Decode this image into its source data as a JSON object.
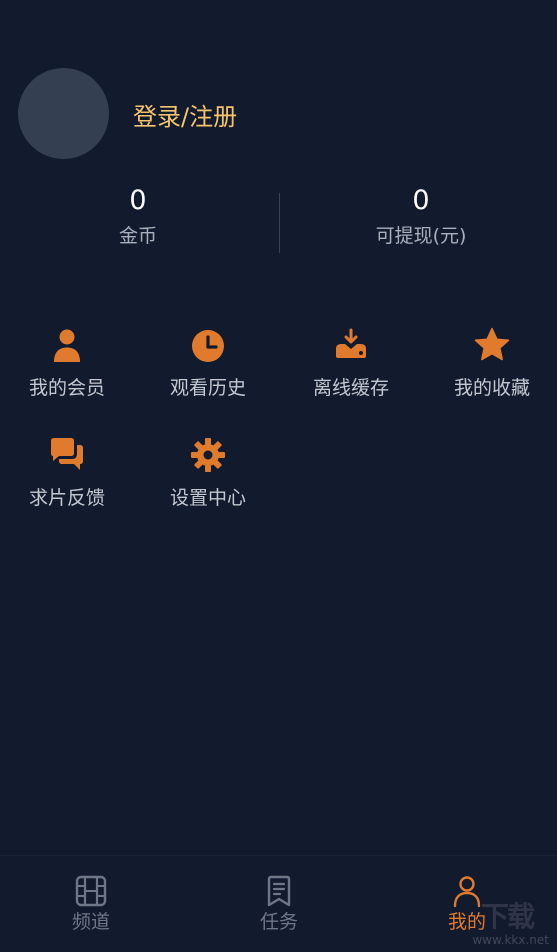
{
  "profile": {
    "login_label": "登录/注册"
  },
  "stats": {
    "coins_value": "0",
    "coins_label": "金币",
    "cash_value": "0",
    "cash_label": "可提现(元)"
  },
  "features": [
    {
      "label": "我的会员",
      "icon": "user-icon"
    },
    {
      "label": "观看历史",
      "icon": "clock-icon"
    },
    {
      "label": "离线缓存",
      "icon": "download-icon"
    },
    {
      "label": "我的收藏",
      "icon": "star-icon"
    },
    {
      "label": "求片反馈",
      "icon": "chat-icon"
    },
    {
      "label": "设置中心",
      "icon": "gear-icon"
    }
  ],
  "tabbar": {
    "tabs": [
      {
        "label": "频道",
        "icon": "film-icon",
        "active": false
      },
      {
        "label": "任务",
        "icon": "task-icon",
        "active": false
      },
      {
        "label": "我的",
        "icon": "person-icon",
        "active": true
      }
    ]
  },
  "watermark": {
    "logo_text": "下载",
    "url": "www.kkx.net"
  },
  "colors": {
    "background": "#121a2d",
    "accent": "#e07b2e",
    "login_text": "#f6c46c",
    "avatar": "#353f52"
  }
}
